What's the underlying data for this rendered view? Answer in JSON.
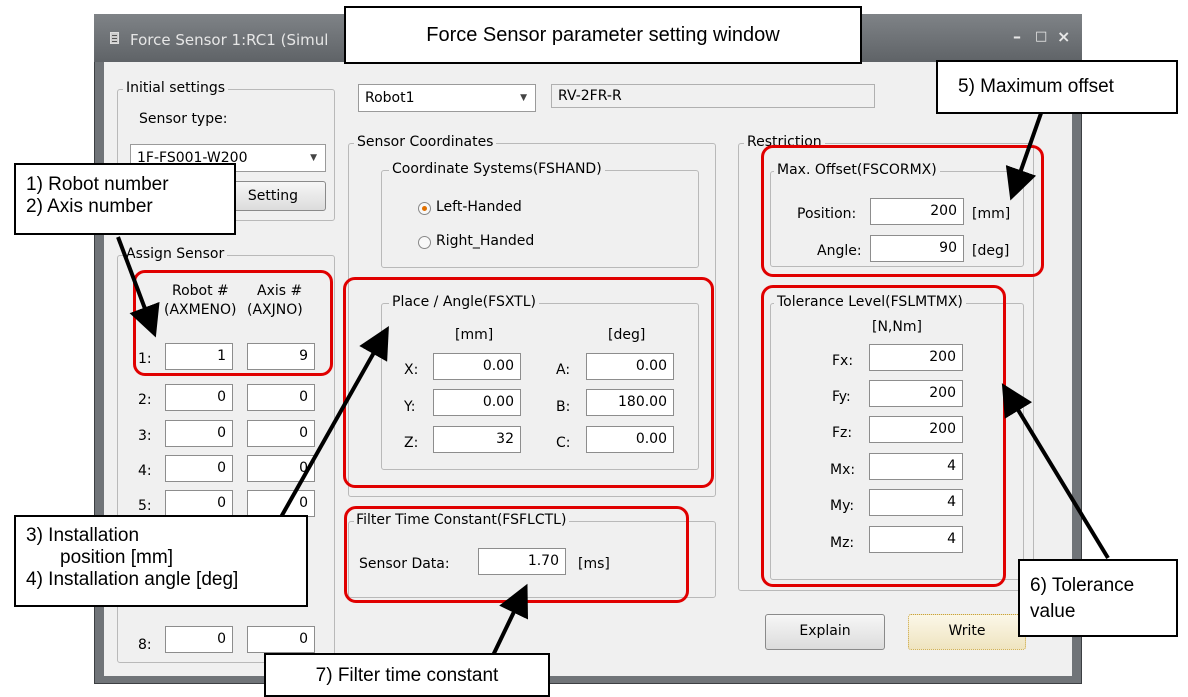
{
  "window": {
    "title": "Force Sensor 1:RC1 (Simul",
    "minimize": "–",
    "maximize": "□",
    "close": "×"
  },
  "initial_settings": {
    "group_label": "Initial settings",
    "sensor_type_label": "Sensor type:",
    "sensor_type_value": "1F-FS001-W200",
    "setting_button": "Setting"
  },
  "assign_sensor": {
    "group_label": "Assign Sensor",
    "col_robot": "Robot #",
    "col_robot_sub": "(AXMENO)",
    "col_axis": "Axis #",
    "col_axis_sub": "(AXJNO)",
    "rows": [
      {
        "label": "1:",
        "robot": "1",
        "axis": "9"
      },
      {
        "label": "2:",
        "robot": "0",
        "axis": "0"
      },
      {
        "label": "3:",
        "robot": "0",
        "axis": "0"
      },
      {
        "label": "4:",
        "robot": "0",
        "axis": "0"
      },
      {
        "label": "5:",
        "robot": "0",
        "axis": "0"
      },
      {
        "label": "8:",
        "robot": "0",
        "axis": "0"
      }
    ]
  },
  "robot_select": {
    "value": "Robot1",
    "model": "RV-2FR-R"
  },
  "sensor_coordinates": {
    "group_label": "Sensor Coordinates",
    "coord_systems_label": "Coordinate Systems(FSHAND)",
    "left_handed": "Left-Handed",
    "right_handed": "Right_Handed",
    "selected": "Left-Handed",
    "place_angle_label": "Place / Angle(FSXTL)",
    "mm_header": "[mm]",
    "deg_header": "[deg]",
    "x_label": "X:",
    "x": "0.00",
    "y_label": "Y:",
    "y": "0.00",
    "z_label": "Z:",
    "z": "32",
    "a_label": "A:",
    "a": "0.00",
    "b_label": "B:",
    "b": "180.00",
    "c_label": "C:",
    "c": "0.00"
  },
  "filter": {
    "group_label": "Filter Time Constant(FSFLCTL)",
    "sensor_data_label": "Sensor Data:",
    "sensor_data": "1.70",
    "unit": "[ms]"
  },
  "restriction": {
    "group_label": "Restriction",
    "max_offset_label": "Max. Offset(FSCORMX)",
    "position_label": "Position:",
    "position": "200",
    "position_unit": "[mm]",
    "angle_label": "Angle:",
    "angle": "90",
    "angle_unit": "[deg]",
    "tolerance_label": "Tolerance Level(FSLMTMX)",
    "tolerance_unit": "[N,Nm]",
    "tolerances": [
      {
        "label": "Fx:",
        "value": "200"
      },
      {
        "label": "Fy:",
        "value": "200"
      },
      {
        "label": "Fz:",
        "value": "200"
      },
      {
        "label": "Mx:",
        "value": "4"
      },
      {
        "label": "My:",
        "value": "4"
      },
      {
        "label": "Mz:",
        "value": "4"
      }
    ]
  },
  "buttons": {
    "explain": "Explain",
    "write": "Write"
  },
  "callouts": {
    "title": "Force Sensor parameter setting window",
    "robot_axis_1": "1) Robot number",
    "robot_axis_2": "2) Axis number",
    "install_1": "3) Installation",
    "install_2": "position [mm]",
    "install_3": "4) Installation angle [deg]",
    "max_offset": "5) Maximum offset",
    "tolerance_1": "6) Tolerance",
    "tolerance_2": "value",
    "filter": "7) Filter time constant"
  }
}
